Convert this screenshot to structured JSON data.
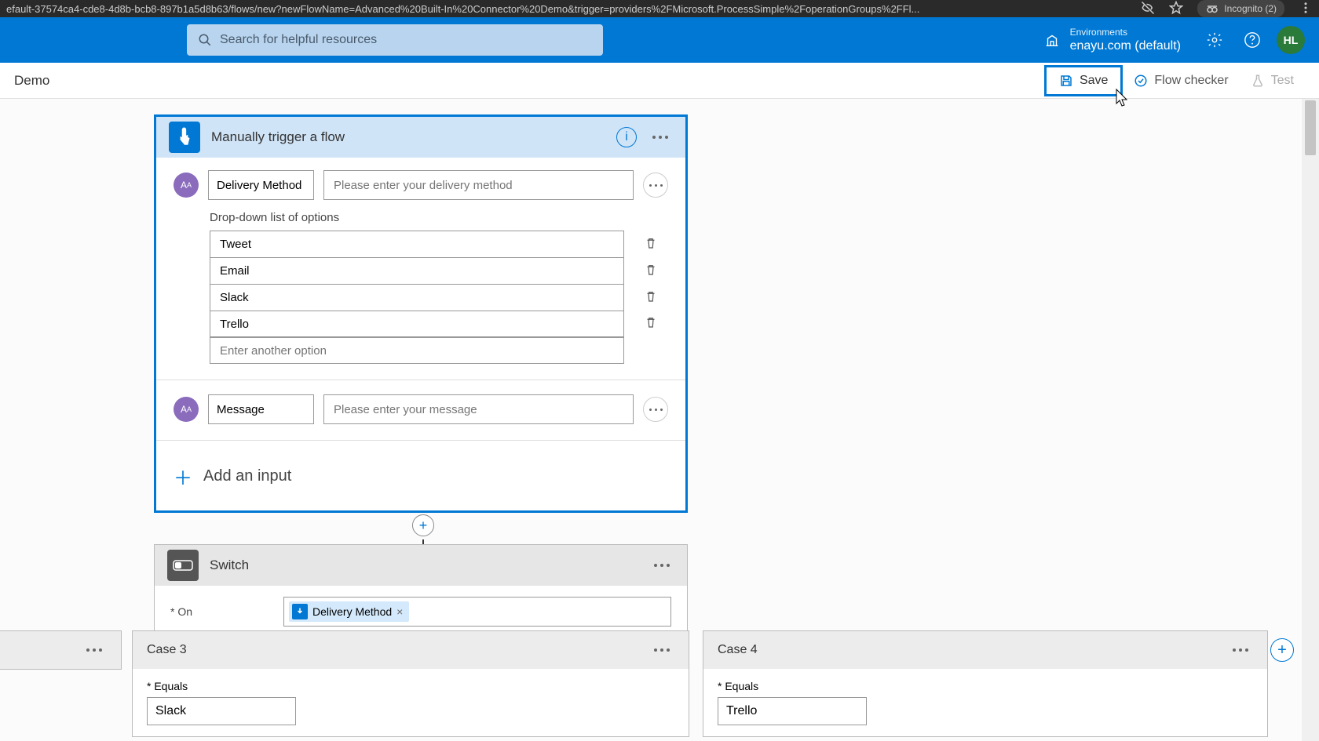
{
  "browser": {
    "url": "efault-37574ca4-cde8-4d8b-bcb8-897b1a5d8b63/flows/new?newFlowName=Advanced%20Built-In%20Connector%20Demo&trigger=providers%2FMicrosoft.ProcessSimple%2FoperationGroups%2FFl...",
    "incognito_label": "Incognito (2)"
  },
  "header": {
    "search_placeholder": "Search for helpful resources",
    "environments_label": "Environments",
    "environment_value": "enayu.com (default)",
    "avatar_initials": "HL"
  },
  "toolbar": {
    "breadcrumb": "Demo",
    "save_label": "Save",
    "flow_checker_label": "Flow checker",
    "test_label": "Test"
  },
  "trigger": {
    "title": "Manually trigger a flow",
    "inputs": [
      {
        "name": "Delivery Method",
        "placeholder": "Please enter your delivery method",
        "dropdown_label": "Drop-down list of options",
        "options": [
          "Tweet",
          "Email",
          "Slack",
          "Trello"
        ],
        "new_option_placeholder": "Enter another option"
      },
      {
        "name": "Message",
        "placeholder": "Please enter your message"
      }
    ],
    "add_input_label": "Add an input"
  },
  "switch": {
    "title": "Switch",
    "on_label": "* On",
    "on_token": "Delivery Method"
  },
  "cases": {
    "case3": {
      "title": "Case 3",
      "equals_label": "* Equals",
      "equals_value": "Slack"
    },
    "case4": {
      "title": "Case 4",
      "equals_label": "* Equals",
      "equals_value": "Trello"
    }
  }
}
